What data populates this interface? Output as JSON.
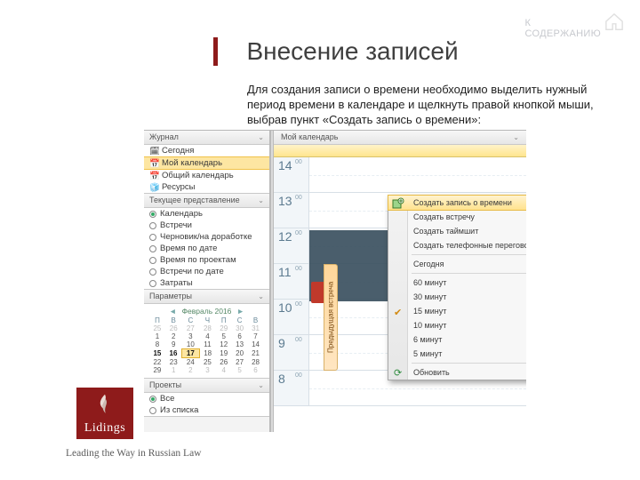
{
  "toc_link": "К\nСОДЕРЖАНИЮ",
  "title": "Внесение записей",
  "body": "Для создания записи о времени необходимо выделить нужный период времени в календаре и щелкнуть правой кнопкой мыши, выбрав пункт «Создать запись о времени»:",
  "sidebar": {
    "pane1_title": "Журнал",
    "nav": [
      {
        "label": "Сегодня"
      },
      {
        "label": "Мой календарь"
      },
      {
        "label": "Общий календарь"
      },
      {
        "label": "Ресурсы"
      }
    ],
    "pane2_title": "Текущее представление",
    "views": [
      {
        "label": "Календарь",
        "on": true
      },
      {
        "label": "Встречи",
        "on": false
      },
      {
        "label": "Черновик/на доработке",
        "on": false
      },
      {
        "label": "Время по дате",
        "on": false
      },
      {
        "label": "Время по проектам",
        "on": false
      },
      {
        "label": "Встречи по дате",
        "on": false
      },
      {
        "label": "Затраты",
        "on": false
      }
    ],
    "pane3_title": "Параметры",
    "cal_month": "Февраль 2016",
    "dow": [
      "П",
      "В",
      "С",
      "Ч",
      "П",
      "С",
      "В"
    ],
    "weeks": [
      [
        "25",
        "26",
        "27",
        "28",
        "29",
        "30",
        "31"
      ],
      [
        "1",
        "2",
        "3",
        "4",
        "5",
        "6",
        "7"
      ],
      [
        "8",
        "9",
        "10",
        "11",
        "12",
        "13",
        "14"
      ],
      [
        "15",
        "16",
        "17",
        "18",
        "19",
        "20",
        "21"
      ],
      [
        "22",
        "23",
        "24",
        "25",
        "26",
        "27",
        "28"
      ],
      [
        "29",
        "1",
        "2",
        "3",
        "4",
        "5",
        "6"
      ]
    ],
    "today_cell": [
      3,
      2
    ],
    "pane4_title": "Проекты",
    "projects": [
      {
        "label": "Все",
        "on": true
      },
      {
        "label": "Из списка",
        "on": false
      }
    ]
  },
  "main_header": "Мой календарь",
  "hours": [
    "8",
    "9",
    "10",
    "11",
    "12",
    "13",
    "14"
  ],
  "minute_label": "00",
  "vtab_label": "Предыдущая встреча",
  "vtab_label2": "К",
  "ctx_menu": [
    {
      "label": "Создать запись о времени",
      "icon": "create",
      "sel": true
    },
    {
      "label": "Создать встречу"
    },
    {
      "label": "Создать таймшит"
    },
    {
      "label": "Создать телефонные переговоры"
    },
    {
      "sep": true
    },
    {
      "label": "Сегодня"
    },
    {
      "sep": true
    },
    {
      "label": "60 минут"
    },
    {
      "label": "30 минут"
    },
    {
      "label": "15 минут",
      "tick": true
    },
    {
      "label": "10 минут"
    },
    {
      "label": "6 минут"
    },
    {
      "label": "5 минут"
    },
    {
      "sep": true
    },
    {
      "label": "Обновить",
      "icon": "refresh"
    }
  ],
  "logo_text": "Lidings",
  "tagline": "Leading the Way in Russian Law"
}
